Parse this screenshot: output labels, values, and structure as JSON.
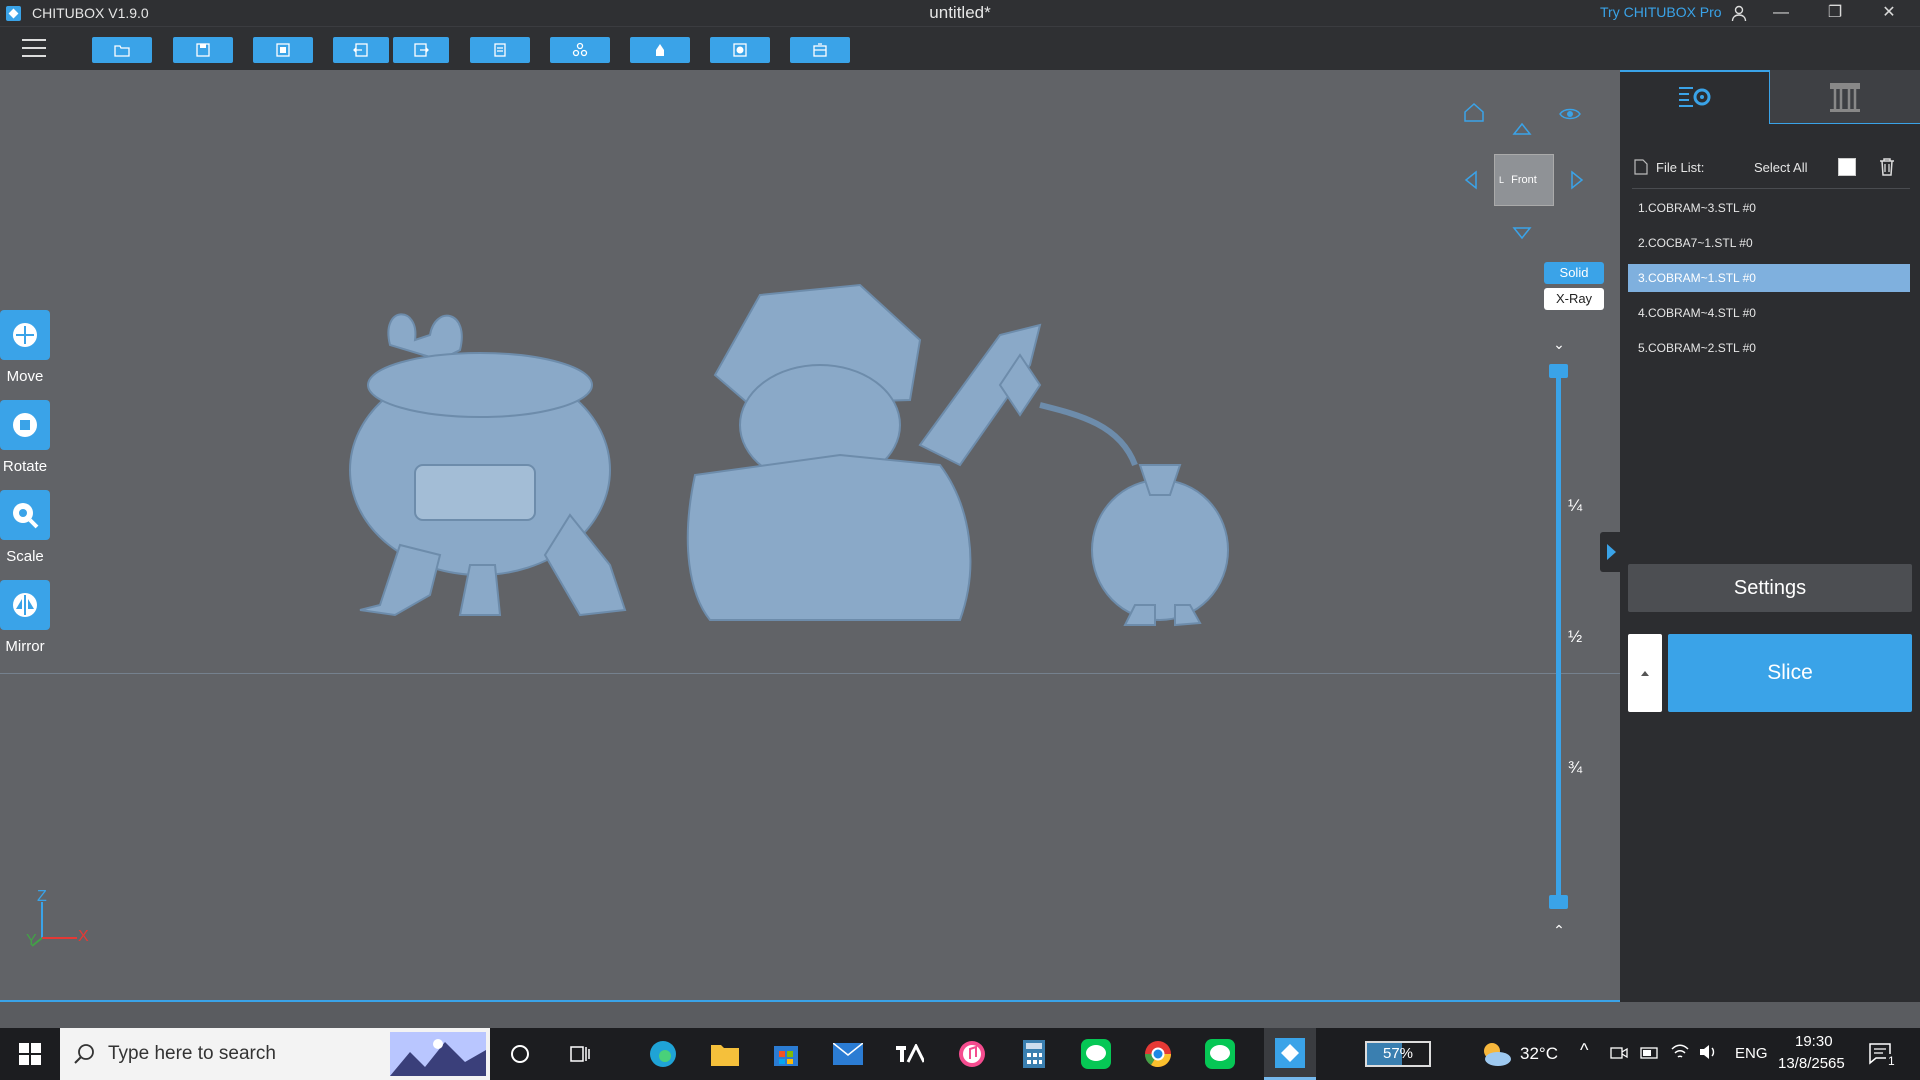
{
  "window": {
    "app_title": "CHITUBOX V1.9.0",
    "doc_title": "untitled*",
    "try_pro": "Try CHITUBOX Pro",
    "minimize": "—",
    "maximize": "❐",
    "close": "✕"
  },
  "left_tools": [
    {
      "label": "Move"
    },
    {
      "label": "Rotate"
    },
    {
      "label": "Scale"
    },
    {
      "label": "Mirror"
    }
  ],
  "view": {
    "cube_face": "Front",
    "cube_side": "L",
    "solid": "Solid",
    "xray": "X-Ray"
  },
  "slider": {
    "quarter": "¼",
    "half": "½",
    "three_quarter": "¾"
  },
  "axes": {
    "z": "Z",
    "y": "Y",
    "x": "X"
  },
  "file_list": {
    "label": "File List:",
    "select_all": "Select All",
    "items": [
      {
        "name": "1.COBRAM~3.STL #0"
      },
      {
        "name": "2.COCBA7~1.STL #0"
      },
      {
        "name": "3.COBRAM~1.STL #0"
      },
      {
        "name": "4.COBRAM~4.STL #0"
      },
      {
        "name": "5.COBRAM~2.STL #0"
      }
    ],
    "active_index": 2
  },
  "buttons": {
    "settings": "Settings",
    "slice": "Slice"
  },
  "taskbar": {
    "search_placeholder": "Type here to search",
    "battery": "57%",
    "temperature": "32°C",
    "language": "ENG",
    "time": "19:30",
    "date": "13/8/2565",
    "notifications": "1"
  },
  "colors": {
    "accent": "#3aa3e8",
    "model": "#8aa9c8",
    "viewport_bg": "#616367"
  }
}
